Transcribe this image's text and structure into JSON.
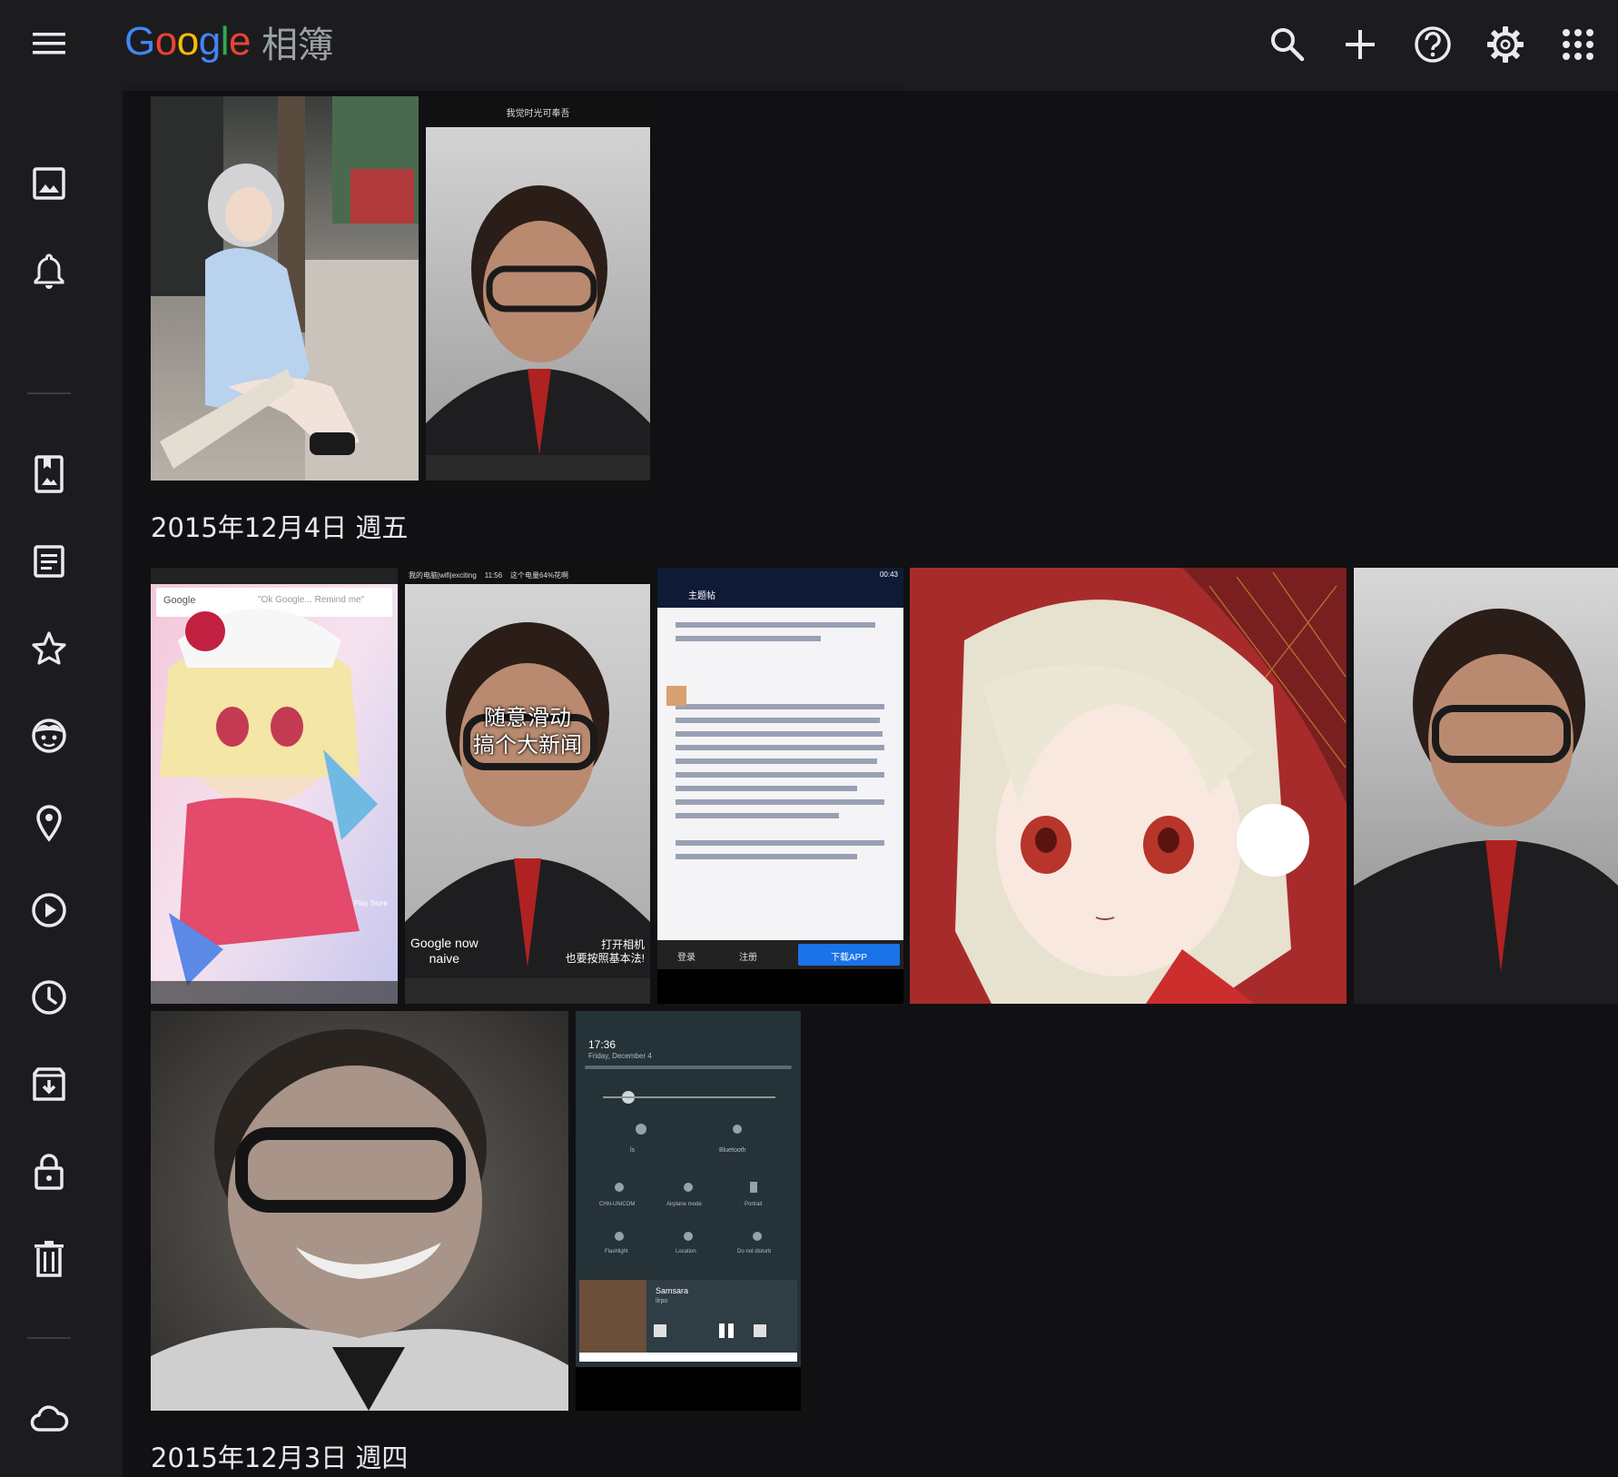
{
  "app": {
    "logo_letters": [
      "G",
      "o",
      "o",
      "g",
      "l",
      "e"
    ],
    "product_name": "相簿"
  },
  "top_icons": [
    "search-icon",
    "add-icon",
    "help-icon",
    "settings-icon",
    "apps-grid-icon"
  ],
  "sidebar_icons": [
    "photos-icon",
    "notifications-icon",
    "albums-icon",
    "documents-icon",
    "favorites-icon",
    "people-icon",
    "places-icon",
    "videos-icon",
    "recent-icon",
    "archive-icon",
    "locked-folder-icon",
    "trash-icon",
    "cloud-storage-icon"
  ],
  "sections": [
    {
      "date": "2015年12月4日 週五"
    },
    {
      "date": "2015年12月3日 週四"
    }
  ],
  "photos": {
    "ui_screenshot": {
      "title": "我觉时光可奉吾",
      "caption_left": "Google now\nnaive",
      "caption_right": "打开相机\n也要按照基本法!"
    },
    "wallpaper": {
      "search_label": "Google",
      "search_hint": "\"Ok Google... Remind me\"",
      "app_label": "Play Store"
    },
    "subtitle_photo": {
      "status": "我的电脑|wifi|exciting    11:56    这个电量64%花啊",
      "overlay_line1": "随意滑动",
      "overlay_line2": "搞个大新闻",
      "caption_left": "Google now\nnaive",
      "caption_right": "打开相机\n也要按照基本法!"
    },
    "forum_screenshot": {
      "status_time": "00:43",
      "title": "主题帖",
      "button": "下载APP",
      "login": "登录",
      "register": "注册"
    },
    "quick_settings": {
      "time": "17:36",
      "date": "Friday, December 4",
      "tile_labels": [
        "CHN-UNICOM",
        "Airplane mode",
        "Portrait",
        "Flashlight",
        "Location",
        "Do not disturb"
      ],
      "wifi_label": "ls",
      "bt_label": "Bluetooth",
      "media_title": "Samsara",
      "media_sub": "ilrpo"
    }
  },
  "colors": {
    "background": "#111113",
    "chrome": "#1c1c1e",
    "icon": "#e8eaed",
    "muted_text": "#9aa0a6",
    "accent_blue": "#1a73e8"
  }
}
